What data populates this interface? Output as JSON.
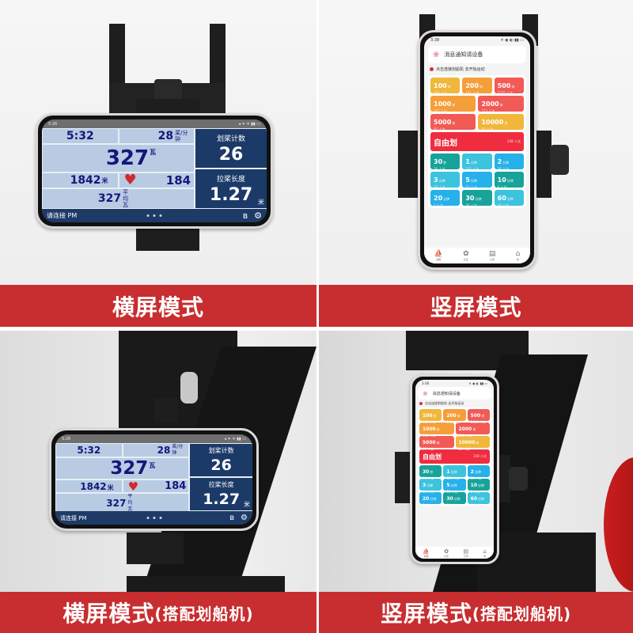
{
  "captions": {
    "top_left": "横屏模式",
    "top_right": "竖屏模式",
    "bottom_left_main": "横屏模式",
    "bottom_left_sub": "(搭配划船机)",
    "bottom_right_main": "竖屏模式",
    "bottom_right_sub": "(搭配划船机)"
  },
  "landscape_app": {
    "status_time": "5:26",
    "status_right": "◂ ✦ ✈ ▮▮ ▭",
    "time_value": "5:32",
    "stroke_rate_value": "28",
    "stroke_rate_unit": "桨/分钟",
    "power_value": "327",
    "power_unit": "瓦",
    "distance_value": "1842",
    "distance_unit": "米",
    "heart_icon": "♥",
    "heart_rate_value": "184",
    "avg_power_value": "327",
    "avg_power_unit": "平均瓦",
    "stroke_count_label": "划桨计数",
    "stroke_count_value": "26",
    "stroke_length_label": "拉桨长度",
    "stroke_length_value": "1.27",
    "stroke_length_unit": "米",
    "connection_status": "请连接 PM",
    "bluetooth_icon": "ʙ",
    "settings_icon": "⚙"
  },
  "portrait_app": {
    "status_time": "3:38",
    "status_right": "✕ ◉ ◐ ▮▮ ▭",
    "header_title": "消息通知请设备",
    "notice_text": "点击连接划船机  去开始运动",
    "tiles": [
      {
        "value": "100",
        "unit": "米",
        "sub": "464 人次",
        "color": "#f0b73c",
        "span": "s2"
      },
      {
        "value": "200",
        "unit": "米",
        "sub": "141 人次",
        "color": "#f59e3a",
        "span": "s2"
      },
      {
        "value": "500",
        "unit": "米",
        "sub": "1025 人次",
        "color": "#f25a56",
        "span": "s2"
      },
      {
        "value": "1000",
        "unit": "米",
        "sub": "362 人次",
        "color": "#f59e3a",
        "span": "s3"
      },
      {
        "value": "2000",
        "unit": "米",
        "sub": "213 人次",
        "color": "#f25a56",
        "span": "s3"
      },
      {
        "value": "5000",
        "unit": "米",
        "sub": "87 人次",
        "color": "#f25a56",
        "span": "s3"
      },
      {
        "value": "10000",
        "unit": "米",
        "sub": "54 人次",
        "color": "#f0b73c",
        "span": "s3"
      },
      {
        "value": "自由划",
        "unit": "",
        "sub": "238 人次",
        "color": "#ef2d3f",
        "span": "s6"
      },
      {
        "value": "30",
        "unit": "秒",
        "sub": "26 人次",
        "color": "#17a39a",
        "span": "s2"
      },
      {
        "value": "1",
        "unit": "分钟",
        "sub": "125 人次",
        "color": "#3cc3de",
        "span": "s2"
      },
      {
        "value": "2",
        "unit": "分钟",
        "sub": "38 人次",
        "color": "#26b1ea",
        "span": "s2"
      },
      {
        "value": "3",
        "unit": "分钟",
        "sub": "34 人次",
        "color": "#3cc3de",
        "span": "s2"
      },
      {
        "value": "5",
        "unit": "分钟",
        "sub": "52 人次",
        "color": "#26b1ea",
        "span": "s2"
      },
      {
        "value": "10",
        "unit": "分钟",
        "sub": "6 人次",
        "color": "#17a39a",
        "span": "s2"
      },
      {
        "value": "20",
        "unit": "分钟",
        "sub": "7 人次",
        "color": "#26b1ea",
        "span": "s2"
      },
      {
        "value": "30",
        "unit": "分钟",
        "sub": "26 人次",
        "color": "#17a39a",
        "span": "s2"
      },
      {
        "value": "60",
        "unit": "分钟",
        "sub": "44 人次",
        "color": "#3cc3de",
        "span": "s2"
      }
    ],
    "nav": [
      {
        "icon": "rowing-icon",
        "glyph": "⛵",
        "label": "训练",
        "active": true
      },
      {
        "icon": "paw-icon",
        "glyph": "✿",
        "label": "社区",
        "active": false
      },
      {
        "icon": "chart-icon",
        "glyph": "▤",
        "label": "记录",
        "active": false
      },
      {
        "icon": "home-icon",
        "glyph": "⌂",
        "label": "我",
        "active": false
      }
    ]
  }
}
